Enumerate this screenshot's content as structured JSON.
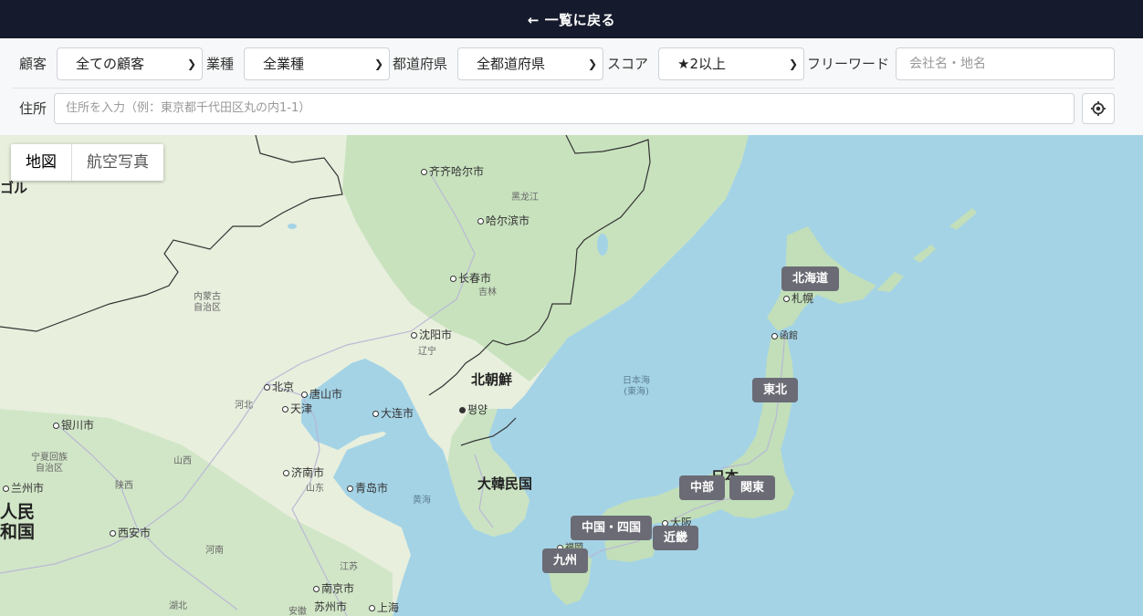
{
  "header": {
    "back_label": "← 一覧に戻る"
  },
  "filters": {
    "customer": {
      "label": "顧客",
      "selected": "全ての顧客"
    },
    "industry": {
      "label": "業種",
      "selected": "全業種"
    },
    "prefecture": {
      "label": "都道府県",
      "selected": "全都道府県"
    },
    "score": {
      "label": "スコア",
      "selected": "★2以上"
    },
    "freeword": {
      "label": "フリーワード",
      "placeholder": "会社名・地名"
    },
    "address": {
      "label": "住所",
      "placeholder": "住所を入力（例：東京都千代田区丸の内1-1）"
    },
    "locate_icon": "crosshair-icon"
  },
  "map": {
    "type_toggle": {
      "map": "地図",
      "satellite": "航空写真"
    },
    "regions": [
      "北海道",
      "東北",
      "中部",
      "関東",
      "中国・四国",
      "近畿",
      "九州"
    ],
    "cities": [
      "齐齐哈尔市",
      "哈尔滨市",
      "长春市",
      "沈阳市",
      "北京",
      "唐山市",
      "天津",
      "大连市",
      "银川市",
      "济南市",
      "青岛市",
      "兰州市",
      "西安市",
      "南京市",
      "苏州市",
      "上海",
      "평양",
      "札幌",
      "函館",
      "大阪",
      "福岡"
    ],
    "provinces": [
      "黑龙江",
      "吉林",
      "辽宁",
      "内蒙古\n自治区",
      "河北",
      "山西",
      "宁夏回族\n自治区",
      "陕西",
      "山东",
      "河南",
      "江苏",
      "湖北",
      "安徽"
    ],
    "countries": [
      "北朝鮮",
      "大韓民国",
      "日本",
      "ゴル",
      "人民\n和国"
    ],
    "seas": [
      "日本海\n(東海)",
      "黄海"
    ],
    "colors": {
      "water": "#a4d3e6",
      "land": "#e8efdd",
      "forest": "#bcdcb4",
      "region_badge": "#6b6b75",
      "topbar": "#151a2c"
    }
  }
}
